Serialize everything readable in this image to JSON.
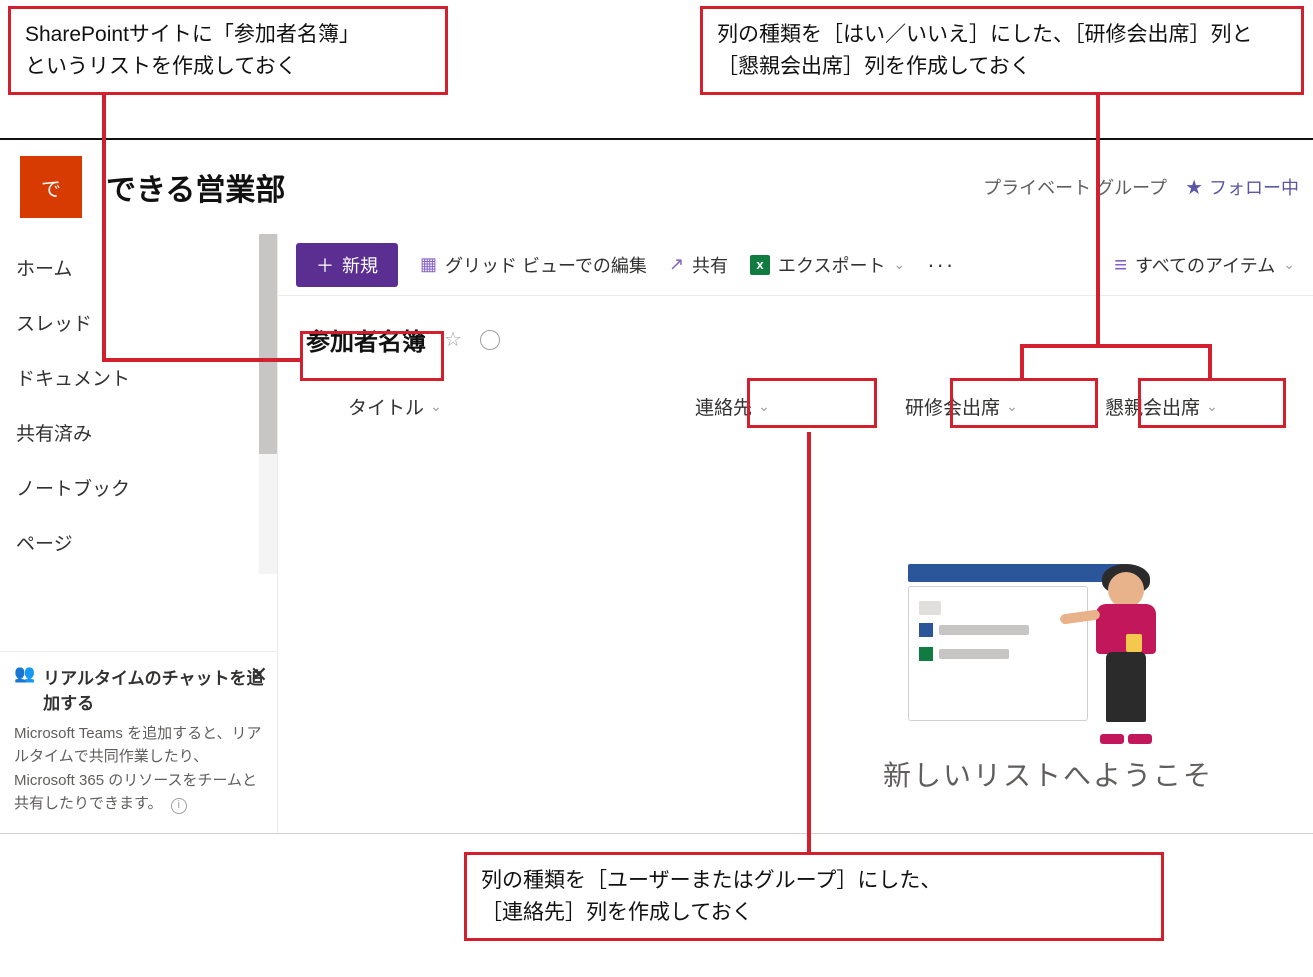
{
  "annotations": {
    "top_left": "SharePointサイトに「参加者名簿」\nというリストを作成しておく",
    "top_right": "列の種類を［はい／いいえ］にした、［研修会出席］列と［懇親会出席］列を作成しておく",
    "bottom": "列の種類を［ユーザーまたはグループ］にした、\n［連絡先］列を作成しておく"
  },
  "site": {
    "logo_char": "で",
    "title": "できる営業部",
    "privacy": "プライベート グループ",
    "follow": "フォロー中"
  },
  "sidebar": {
    "items": [
      {
        "label": "ホーム"
      },
      {
        "label": "スレッド"
      },
      {
        "label": "ドキュメント"
      },
      {
        "label": "共有済み"
      },
      {
        "label": "ノートブック"
      },
      {
        "label": "ページ"
      }
    ]
  },
  "promo": {
    "title": "リアルタイムのチャットを追加する",
    "body": "Microsoft Teams を追加すると、リアルタイムで共同作業したり、Microsoft 365 のリソースをチームと共有したりできます。"
  },
  "cmdbar": {
    "new": "新規",
    "grid": "グリッド ビューでの編集",
    "share": "共有",
    "export": "エクスポート",
    "view": "すべてのアイテム"
  },
  "list": {
    "title": "参加者名簿",
    "columns": {
      "title": "タイトル",
      "contact": "連絡先",
      "training": "研修会出席",
      "party": "懇親会出席"
    },
    "welcome": "新しいリストへようこそ"
  }
}
